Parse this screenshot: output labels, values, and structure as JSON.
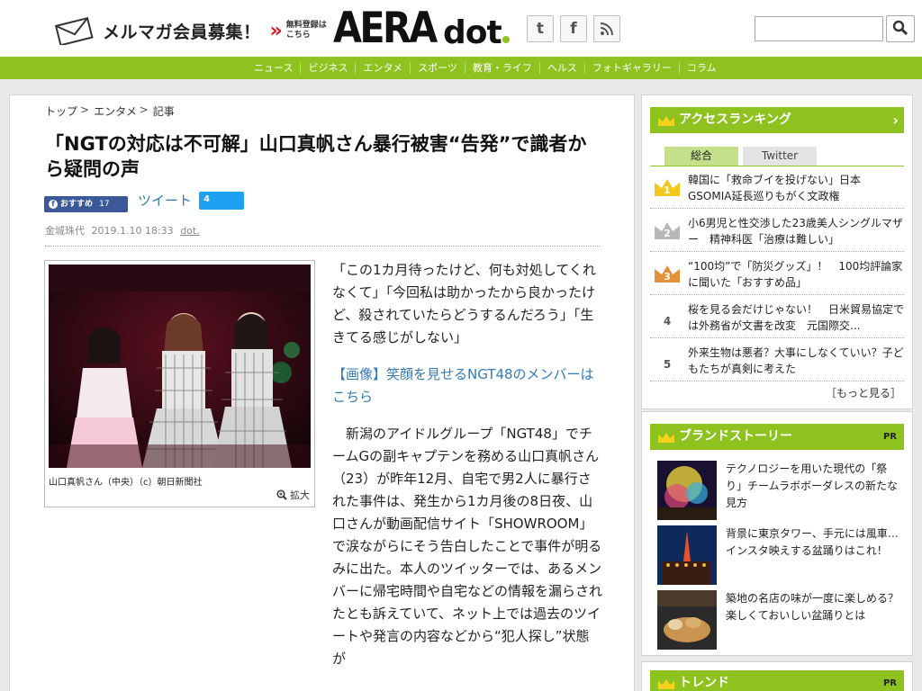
{
  "header": {
    "mail_label": "メルマガ会員募集！",
    "mail_sub_line1": "無料登録は",
    "mail_sub_line2": "こちら",
    "logo_aera": "AERA",
    "logo_dot": "dot",
    "search_placeholder": ""
  },
  "nav": [
    "ニュース",
    "ビジネス",
    "エンタメ",
    "スポーツ",
    "教育・ライフ",
    "ヘルス",
    "フォトギャラリー",
    "コラム"
  ],
  "breadcrumb": {
    "top": "トップ",
    "category": "エンタメ",
    "current": "記事"
  },
  "article": {
    "title": "「NGTの対応は不可解」山口真帆さん暴行被害“告発”で識者から疑問の声",
    "fb_label": "おすすめ",
    "fb_count": "17",
    "tweet_label": "ツイート",
    "tweet_count": "4",
    "author": "金城珠代",
    "date": "2019.1.10 18:33",
    "source": "dot.",
    "photo_caption": "山口真帆さん（中央）（c）朝日新聞社",
    "zoom_label": "拡大",
    "paragraphs": [
      "「この1カ月待ったけど、何も対処してくれなくて」「今回私は助かったから良かったけど、殺されていたらどうするんだろう」「生きてる感じがしない」",
      "【画像】笑顔を見せるNGT48のメンバーはこちら",
      "新潟のアイドルグループ「NGT48」でチームGの副キャプテンを務める山口真帆さん（23）が昨年12月、自宅で男2人に暴行された事件は、発生から1カ月後の8日夜、山口さんが動画配信サイト「SHOWROOM」で涙ながらにそう告白したことで事件が明るみに出た。本人のツイッターでは、あるメンバーに帰宅時間や自宅などの情報を漏らされたとも訴えていて、ネット上では過去のツイートや発言の内容などから“犯人探し”状態が"
    ]
  },
  "ranking": {
    "title": "アクセスランキング",
    "tabs": [
      "総合",
      "Twitter"
    ],
    "items": [
      {
        "rank": "1",
        "text": "韓国に「救命ブイを投げない」日本 GSOMIA延長巡りもがく文政権"
      },
      {
        "rank": "2",
        "text": "小6男児と性交渉した23歳美人シングルマザー　精神科医「治療は難しい」"
      },
      {
        "rank": "3",
        "text": "“100均”で「防災グッズ」！　100均評論家に聞いた「おすすめ品」"
      },
      {
        "rank": "4",
        "text": "桜を見る会だけじゃない！　日米貿易協定では外務省が文書を改変　元国際交..."
      },
      {
        "rank": "5",
        "text": "外来生物は悪者？大事にしなくていい？子どもたちが真剣に考えた"
      }
    ],
    "more": "［もっと見る］"
  },
  "brand_story": {
    "title": "ブランドストーリー",
    "pr": "PR",
    "items": [
      {
        "text": "テクノロジーを用いた現代の「祭り」チームラボボーダレスの新たな見方"
      },
      {
        "text": "背景に東京タワー、手元には風車…インスタ映えする盆踊りはこれ！"
      },
      {
        "text": "築地の名店の味が一度に楽しめる？楽しくておいしい盆踊りとは"
      }
    ]
  },
  "trend": {
    "title": "トレンド",
    "pr": "PR"
  },
  "colors": {
    "accent": "#8dc21f",
    "link": "#3279b7",
    "facebook": "#3b5998",
    "twitter": "#1da1f2"
  }
}
